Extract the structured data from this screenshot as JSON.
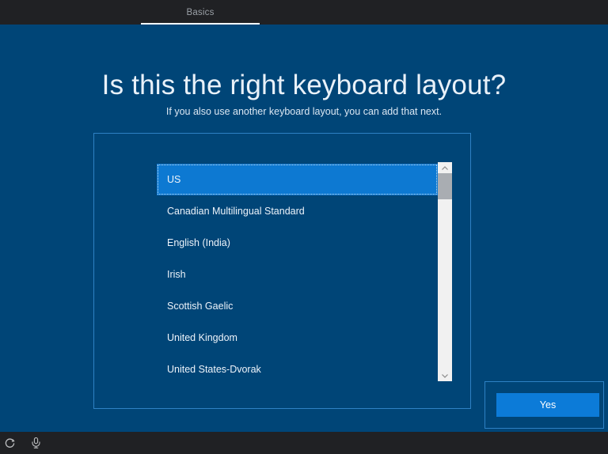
{
  "topbar": {
    "tab_label": "Basics"
  },
  "main": {
    "title": "Is this the right keyboard layout?",
    "subtitle": "If you also use another keyboard layout, you can add that next.",
    "selected_index": 0,
    "keyboard_layouts": [
      {
        "label": "US"
      },
      {
        "label": "Canadian Multilingual Standard"
      },
      {
        "label": "English (India)"
      },
      {
        "label": "Irish"
      },
      {
        "label": "Scottish Gaelic"
      },
      {
        "label": "United Kingdom"
      },
      {
        "label": "United States-Dvorak"
      }
    ],
    "yes_button_label": "Yes"
  },
  "bottombar": {
    "icons": [
      "ease-of-access-icon",
      "microphone-icon"
    ]
  },
  "colors": {
    "background": "#004577",
    "bar": "#202124",
    "accent": "#0c7bd8",
    "panel_border": "#2e81c4",
    "selected_row": "#0d79d2",
    "tab_underline": "#ffffff"
  }
}
